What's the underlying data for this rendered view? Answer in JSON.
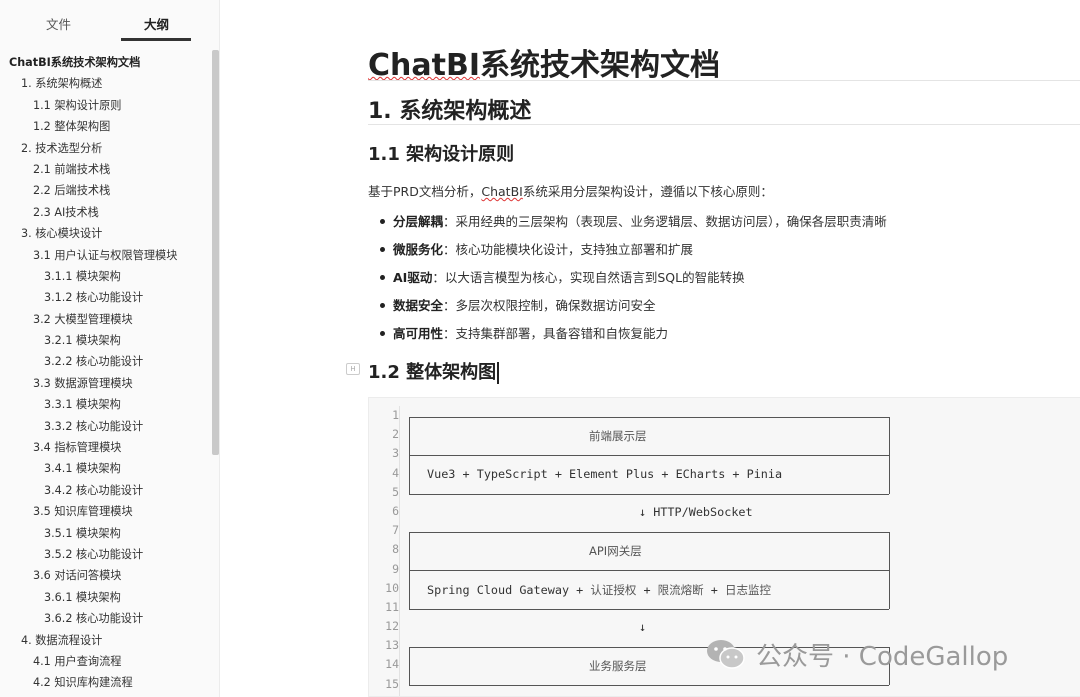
{
  "sidebar": {
    "tabs": {
      "files": "文件",
      "outline": "大纲"
    },
    "outline": [
      {
        "label": "ChatBI系统技术架构文档",
        "level": 0
      },
      {
        "label": "1. 系统架构概述",
        "level": 1
      },
      {
        "label": "1.1 架构设计原则",
        "level": 2
      },
      {
        "label": "1.2 整体架构图",
        "level": 2
      },
      {
        "label": "2. 技术选型分析",
        "level": 1
      },
      {
        "label": "2.1 前端技术栈",
        "level": 2
      },
      {
        "label": "2.2 后端技术栈",
        "level": 2
      },
      {
        "label": "2.3 AI技术栈",
        "level": 2
      },
      {
        "label": "3. 核心模块设计",
        "level": 1
      },
      {
        "label": "3.1 用户认证与权限管理模块",
        "level": 2
      },
      {
        "label": "3.1.1 模块架构",
        "level": 3
      },
      {
        "label": "3.1.2 核心功能设计",
        "level": 3
      },
      {
        "label": "3.2 大模型管理模块",
        "level": 2
      },
      {
        "label": "3.2.1 模块架构",
        "level": 3
      },
      {
        "label": "3.2.2 核心功能设计",
        "level": 3
      },
      {
        "label": "3.3 数据源管理模块",
        "level": 2
      },
      {
        "label": "3.3.1 模块架构",
        "level": 3
      },
      {
        "label": "3.3.2 核心功能设计",
        "level": 3
      },
      {
        "label": "3.4 指标管理模块",
        "level": 2
      },
      {
        "label": "3.4.1 模块架构",
        "level": 3
      },
      {
        "label": "3.4.2 核心功能设计",
        "level": 3
      },
      {
        "label": "3.5 知识库管理模块",
        "level": 2
      },
      {
        "label": "3.5.1 模块架构",
        "level": 3
      },
      {
        "label": "3.5.2 核心功能设计",
        "level": 3
      },
      {
        "label": "3.6 对话问答模块",
        "level": 2
      },
      {
        "label": "3.6.1 模块架构",
        "level": 3
      },
      {
        "label": "3.6.2 核心功能设计",
        "level": 3
      },
      {
        "label": "4. 数据流程设计",
        "level": 1
      },
      {
        "label": "4.1 用户查询流程",
        "level": 2
      },
      {
        "label": "4.2 知识库构建流程",
        "level": 2
      }
    ]
  },
  "doc": {
    "title_err": "ChatBI",
    "title_rest": "系统技术架构文档",
    "h1": "1. 系统架构概述",
    "h2_principles": "1.1 架构设计原则",
    "intro_pre": "基于PRD文档分析，",
    "intro_err": "ChatBI",
    "intro_post": "系统采用分层架构设计，遵循以下核心原则：",
    "bullets": [
      {
        "term": "分层解耦",
        "text": "：采用经典的三层架构（表现层、业务逻辑层、数据访问层），确保各层职责清晰"
      },
      {
        "term": "微服务化",
        "text": "：核心功能模块化设计，支持独立部署和扩展"
      },
      {
        "term": "AI驱动",
        "text": "：以大语言模型为核心，实现自然语言到SQL的智能转换"
      },
      {
        "term": "数据安全",
        "text": "：多层次权限控制，确保数据访问安全"
      },
      {
        "term": "高可用性",
        "text": "：支持集群部署，具备容错和自恢复能力"
      }
    ],
    "h2_arch": "1.2 整体架构图"
  },
  "code": {
    "line_numbers": [
      "1",
      "2",
      "3",
      "4",
      "5",
      "6",
      "7",
      "8",
      "9",
      "10",
      "11",
      "12",
      "13",
      "14",
      "15"
    ],
    "frontend_title": "前端展示层",
    "frontend_stack": "Vue3 + TypeScript + Element Plus + ECharts + Pinia",
    "arrow1": "↓ HTTP/WebSocket",
    "gateway_title": "API网关层",
    "gateway_pre": "Spring Cloud Gateway + ",
    "gateway_a": "认证授权",
    "gateway_b": "限流熔断",
    "gateway_c": "日志监控",
    "plus": " + ",
    "arrow2": "↓",
    "service_title": "业务服务层"
  },
  "watermark": {
    "text": "公众号 · CodeGallop",
    "icon": "wechat-icon"
  }
}
